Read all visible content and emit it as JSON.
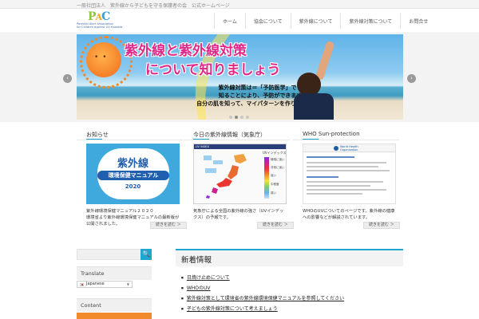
{
  "tagline": "一般社団法人　紫外線から子どもを守る保護者の会　公式ホームページ",
  "logo": {
    "mark": [
      "P",
      "A",
      "C"
    ],
    "subtitle_lines": [
      "Parental Alert Association",
      "for Children against UV Hazards"
    ]
  },
  "nav": {
    "items": [
      "ホーム",
      "協会について",
      "紫外線について",
      "紫外線対策について",
      "お問合せ"
    ]
  },
  "hero": {
    "title_line1": "紫外線と紫外線対策",
    "title_line2": "について知りましょう",
    "body_lines": [
      "紫外線対策は＝「予防医学」です",
      "知ることにより、予防ができます",
      "自分の肌を知って、マイパターンを作りましょう！"
    ],
    "dots_total": 4,
    "active_dot": 1
  },
  "boxes": [
    {
      "title": "お知らせ",
      "image_text": [
        "紫外線",
        "環境保健マニュアル",
        "2020"
      ],
      "body": "紫外線環境保健マニュアル２０２０\n環境省より紫外線環境保健マニュアルの最新版が公開されました。",
      "more_label": "続きを読む ＞"
    },
    {
      "title": "今日の紫外線情報（気象庁）",
      "legend_title": "UVインデックス",
      "legend_labels": [
        "極端に強い",
        "非常に強い",
        "強い",
        "中程度",
        "弱い"
      ],
      "body": "気象庁による全国の紫外線の強さ（UVインデックス）の予報です。",
      "more_label": "続きを読む ＞"
    },
    {
      "title": "WHO Sun-protection",
      "who_name": [
        "World Health",
        "Organization"
      ],
      "body": "WHOのUVについてのページです。紫外線の健康への影響などが解説されています。",
      "more_label": "続きを読む ＞"
    }
  ],
  "sidebar": {
    "search_button": "🔍",
    "translate_heading": "Translate",
    "language_selected": "Japanese",
    "content_heading": "Content"
  },
  "main": {
    "title": "新着情報",
    "items": [
      "日焼け止めについて",
      "WHOのUV",
      "紫外線対策として環境省の紫外線環境保健マニュアルを参照してください",
      "子どもの紫外線対策について考えましょう"
    ]
  },
  "colors": {
    "accent": "#1ea6d3",
    "hero_title": "#e0288a",
    "sidebar_orange": "#f28a2c"
  }
}
